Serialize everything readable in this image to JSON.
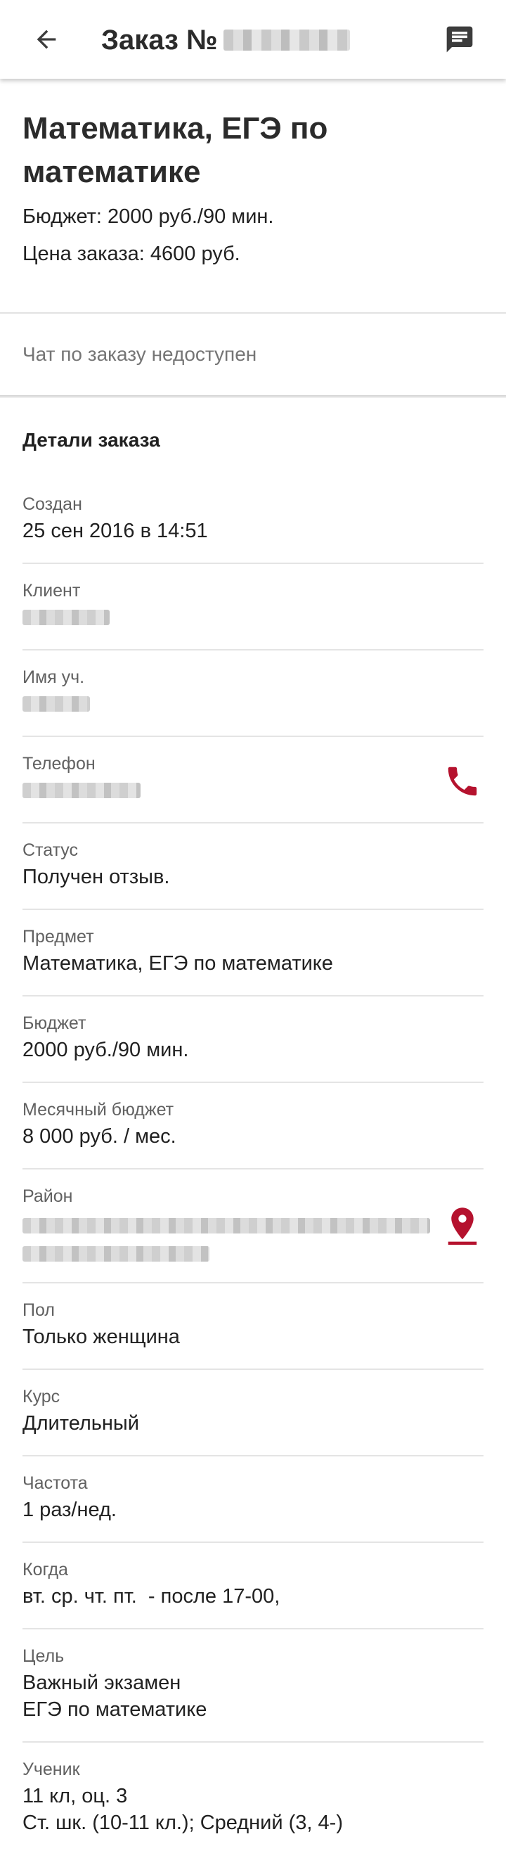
{
  "appbar": {
    "title": "Заказ №",
    "back_icon": "arrow-left-icon",
    "chat_icon": "message-icon"
  },
  "header": {
    "subject": "Математика, ЕГЭ по математике",
    "budget": "Бюджет: 2000 руб./90 мин.",
    "price": "Цена заказа: 4600 руб."
  },
  "chat_status": "Чат по заказу недоступен",
  "details": {
    "title": "Детали заказа",
    "created": {
      "label": "Создан",
      "value": "25 сен 2016 в 14:51"
    },
    "client": {
      "label": "Клиент"
    },
    "student_name": {
      "label": "Имя уч."
    },
    "phone": {
      "label": "Телефон",
      "icon": "phone-icon"
    },
    "status": {
      "label": "Статус",
      "value": "Получен отзыв."
    },
    "subject": {
      "label": "Предмет",
      "value": "Математика, ЕГЭ по математике"
    },
    "budget": {
      "label": "Бюджет",
      "value": "2000 руб./90 мин."
    },
    "monthly_budget": {
      "label": "Месячный бюджет",
      "value": "8 000 руб. / мес."
    },
    "district": {
      "label": "Район",
      "icon": "map-pin-icon"
    },
    "gender": {
      "label": "Пол",
      "value": "Только женщина"
    },
    "course": {
      "label": "Курс",
      "value": "Длительный"
    },
    "frequency": {
      "label": "Частота",
      "value": "1 раз/нед."
    },
    "when": {
      "label": "Когда",
      "value": "вт. ср. чт. пт.  - после 17-00,"
    },
    "goal": {
      "label": "Цель",
      "value_line1": "Важный экзамен",
      "value_line2": "ЕГЭ по математике"
    },
    "student": {
      "label": "Ученик",
      "value_line1": "11 кл, оц. 3",
      "value_line2": "Ст. шк. (10-11 кл.); Средний (3, 4-)"
    }
  },
  "colors": {
    "accent": "#b5122e",
    "icon_dark": "#3c3c3c"
  }
}
